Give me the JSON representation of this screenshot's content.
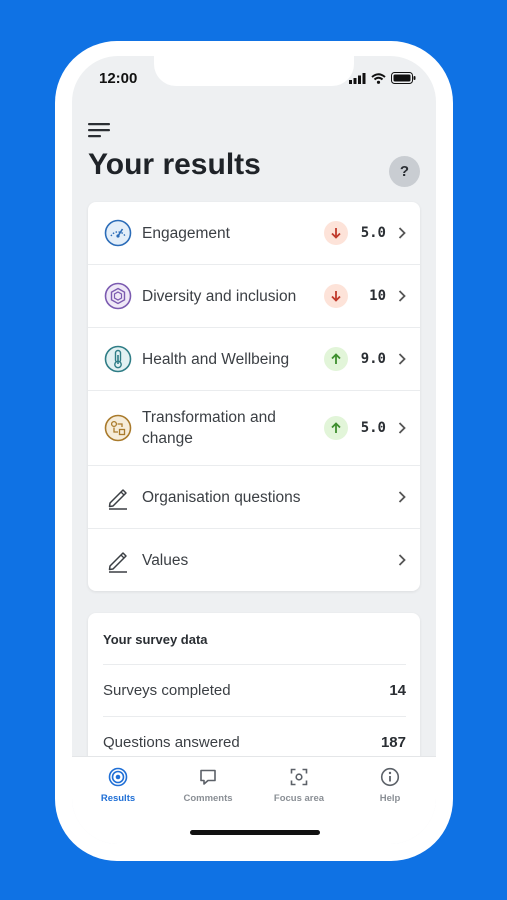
{
  "status_bar": {
    "time": "12:00"
  },
  "header": {
    "title": "Your results",
    "help_label": "?"
  },
  "results": [
    {
      "label": "Engagement",
      "trend": "down",
      "score": "5.0",
      "icon": "speedometer-icon",
      "color": "#2b6cb8"
    },
    {
      "label": "Diversity and inclusion",
      "trend": "down",
      "score": "10",
      "icon": "hexagon-network-icon",
      "color": "#7b5ab0"
    },
    {
      "label": "Health and Wellbeing",
      "trend": "up",
      "score": "9.0",
      "icon": "thermometer-icon",
      "color": "#2f7d86"
    },
    {
      "label": "Transformation and change",
      "trend": "up",
      "score": "5.0",
      "icon": "transform-icon",
      "color": "#a97a2b"
    },
    {
      "label": "Organisation questions",
      "icon": "pencil-icon"
    },
    {
      "label": "Values",
      "icon": "pencil-icon"
    }
  ],
  "survey": {
    "title": "Your survey data",
    "rows": [
      {
        "label": "Surveys completed",
        "value": "14"
      },
      {
        "label": "Questions answered",
        "value": "187"
      }
    ]
  },
  "tabs": [
    {
      "label": "Results",
      "icon": "target-icon",
      "active": true
    },
    {
      "label": "Comments",
      "icon": "comment-icon",
      "active": false
    },
    {
      "label": "Focus area",
      "icon": "focus-icon",
      "active": false
    },
    {
      "label": "Help",
      "icon": "info-icon",
      "active": false
    }
  ],
  "colors": {
    "accent": "#1f6fd6",
    "background": "#0f72e4",
    "trend_down": "#c0392b",
    "trend_up": "#3e8e2e"
  }
}
